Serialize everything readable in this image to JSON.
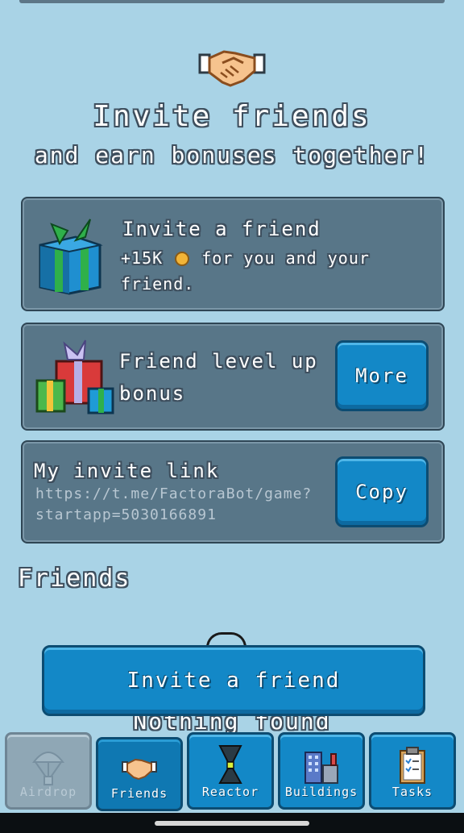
{
  "header": {
    "title": "Invite friends",
    "subtitle": "and earn bonuses together!"
  },
  "cards": {
    "invite": {
      "title": "Invite a friend",
      "desc_prefix": "+15K",
      "desc_suffix": "for you and your",
      "desc_line2": "friend."
    },
    "levelup": {
      "title": "Friend level up",
      "desc": "bonus",
      "button": "More"
    },
    "link": {
      "title": "My invite link",
      "url_line1": "https://t.me/FactoraBot/game?",
      "url_line2": "startapp=5030166891",
      "button": "Copy"
    }
  },
  "friends": {
    "heading": "Friends",
    "empty": "Nothing found",
    "invite_button": "Invite a friend"
  },
  "nav": {
    "items": [
      {
        "label": "Airdrop",
        "icon": "parachute-icon",
        "active": false,
        "disabled": true
      },
      {
        "label": "Friends",
        "icon": "handshake-icon",
        "active": true
      },
      {
        "label": "Reactor",
        "icon": "reactor-icon",
        "active": false
      },
      {
        "label": "Buildings",
        "icon": "buildings-icon",
        "active": false
      },
      {
        "label": "Tasks",
        "icon": "clipboard-icon",
        "active": false
      }
    ]
  },
  "colors": {
    "background": "#a9d3e6",
    "card": "#587688",
    "button": "#1388c7"
  }
}
